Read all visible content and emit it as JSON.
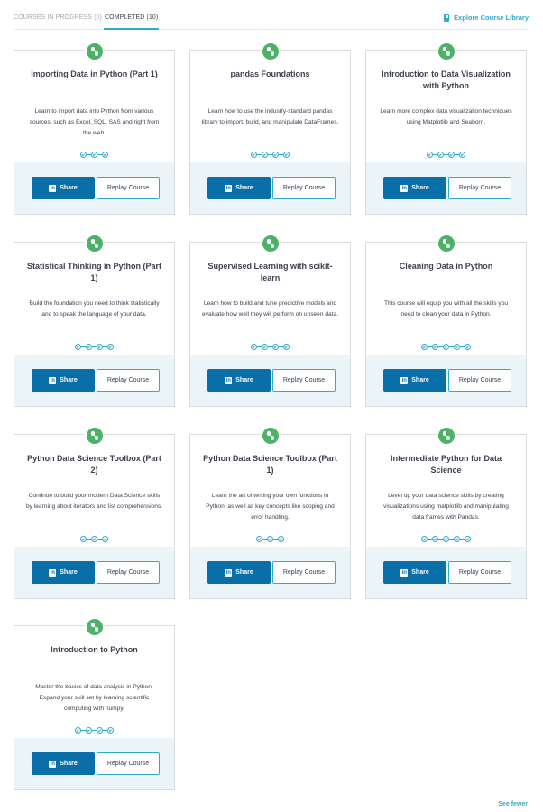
{
  "tabs": {
    "in_progress": "COURSES IN PROGRESS (0)",
    "completed": "COMPLETED (10)"
  },
  "explore": "Explore Course Library",
  "share_label": "Share",
  "replay_label": "Replay Course",
  "linkedin_glyph": "in",
  "see_fewer": "See fewer",
  "accent_color": "#33aacc",
  "share_color": "#0a6ea8",
  "badge_color": "#4fb06a",
  "courses": [
    {
      "title": "Importing Data in Python (Part 1)",
      "description": "Learn to import data into Python from various sources, such as Excel, SQL, SAS and right from the web.",
      "chapters": 3
    },
    {
      "title": "pandas Foundations",
      "description": "Learn how to use the industry-standard pandas library to import, build, and manipulate DataFrames.",
      "chapters": 4
    },
    {
      "title": "Introduction to Data Visualization with Python",
      "description": "Learn more complex data visualization techniques using Matplotlib and Seaborn.",
      "chapters": 4
    },
    {
      "title": "Statistical Thinking in Python (Part 1)",
      "description": "Build the foundation you need to think statistically and to speak the language of your data.",
      "chapters": 4
    },
    {
      "title": "Supervised Learning with scikit-learn",
      "description": "Learn how to build and tune predictive models and evaluate how well they will perform on unseen data.",
      "chapters": 4
    },
    {
      "title": "Cleaning Data in Python",
      "description": "This course will equip you with all the skills you need to clean your data in Python.",
      "chapters": 5
    },
    {
      "title": "Python Data Science Toolbox (Part 2)",
      "description": "Continue to build your modern Data Science skills by learning about iterators and list comprehensions.",
      "chapters": 3
    },
    {
      "title": "Python Data Science Toolbox (Part 1)",
      "description": "Learn the art of writing your own functions in Python, as well as key concepts like scoping and error handling.",
      "chapters": 3
    },
    {
      "title": "Intermediate Python for Data Science",
      "description": "Level up your data science skills by creating visualizations using matplotlib and manipulating data frames with Pandas.",
      "chapters": 5
    },
    {
      "title": "Introduction to Python",
      "description": "Master the basics of data analysis in Python. Expand your skill set by learning scientific computing with numpy.",
      "chapters": 4
    }
  ]
}
